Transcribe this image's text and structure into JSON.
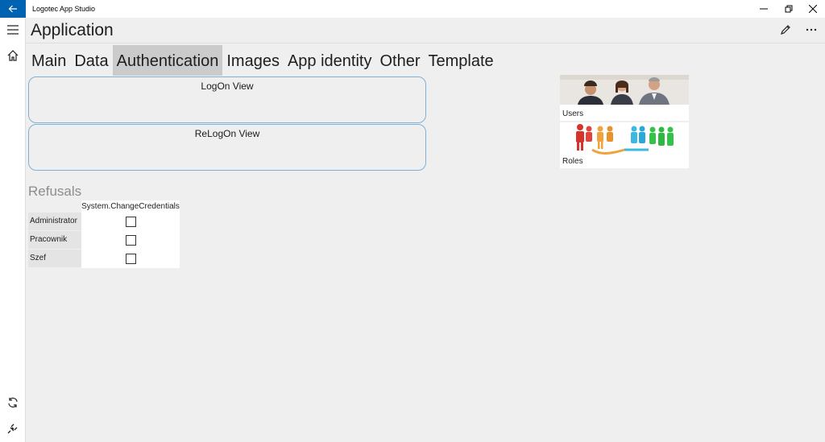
{
  "window": {
    "app_name": "Logotec App Studio"
  },
  "header": {
    "title": "Application"
  },
  "tabs": [
    {
      "label": "Main",
      "active": false
    },
    {
      "label": "Data",
      "active": false
    },
    {
      "label": "Authentication",
      "active": true
    },
    {
      "label": "Images",
      "active": false
    },
    {
      "label": "App identity",
      "active": false
    },
    {
      "label": "Other",
      "active": false
    },
    {
      "label": "Template",
      "active": false
    }
  ],
  "views": {
    "logon": "LogOn View",
    "relogon": "ReLogOn View"
  },
  "tiles": {
    "users": "Users",
    "roles": "Roles"
  },
  "refusals": {
    "title": "Refusals",
    "column": "System.ChangeCredentials",
    "rows": [
      {
        "label": "Administrator",
        "checked": false
      },
      {
        "label": "Pracownik",
        "checked": false
      },
      {
        "label": "Szef",
        "checked": false
      }
    ]
  },
  "colors": {
    "accent": "#0063b1",
    "active_tab": "#cbcbcb",
    "box_border": "#7fb1d8",
    "background": "#efefef"
  },
  "icons": {
    "back": "back-arrow-icon",
    "menu": "hamburger-icon",
    "home": "home-icon",
    "sync": "sync-icon",
    "plug": "plug-icon",
    "edit": "pencil-icon",
    "more": "more-icon"
  }
}
